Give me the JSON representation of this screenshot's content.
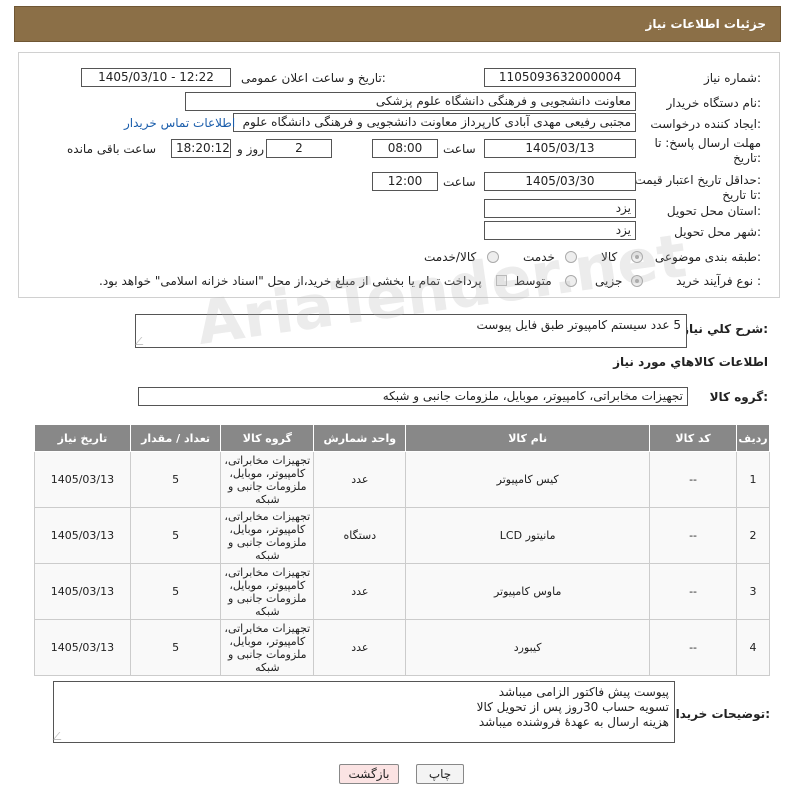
{
  "header": {
    "title": "جزئیات اطلاعات نیاز"
  },
  "fields": {
    "need_number_label": "شماره نیاز:",
    "need_number": "1105093632000004",
    "announce_label": "تاریخ و ساعت اعلان عمومی:",
    "announce_value": "1405/03/10 - 12:22",
    "buyer_org_label": "نام دستگاه خریدار:",
    "buyer_org": "معاونت دانشجویی و فرهنگی دانشگاه علوم پزشکی",
    "creator_label": "ایجاد کننده درخواست:",
    "creator": "مجتبی رفیعی مهدی آبادی کارپرداز معاونت دانشجویی و فرهنگی دانشگاه علوم",
    "contact_link": "اطلاعات تماس خریدار",
    "deadline_label_1": "مهلت ارسال پاسخ: تا",
    "deadline_label_2": "تاریخ:",
    "deadline_date": "1405/03/13",
    "time_label": "ساعت",
    "deadline_time": "08:00",
    "days_value": "2",
    "days_label": "روز و",
    "remaining_time": "18:20:12",
    "remaining_label": "ساعت باقی مانده",
    "price_label_1": "حداقل تاریخ اعتبار قیمت:",
    "price_label_2": "تا تاریخ:",
    "price_date": "1405/03/30",
    "price_time": "12:00",
    "province_label": "استان محل تحویل:",
    "province": "یزد",
    "city_label": "شهر محل تحویل:",
    "city": "یزد",
    "category_label": "طبقه بندی موضوعی:",
    "category_options": [
      "کالا",
      "خدمت",
      "کالا/خدمت"
    ],
    "process_label": "نوع فرآیند خرید :",
    "process_options": [
      "جزیی",
      "متوسط"
    ],
    "payment_note": "پرداخت تمام یا بخشی از مبلغ خرید،از محل \"اسناد خزانه اسلامی\" خواهد بود."
  },
  "summary": {
    "label": "شرح کلي نياز:",
    "value": "5 عدد سیستم کامپیوتر طبق فایل پیوست"
  },
  "goods_info": {
    "heading": "اطلاعات کالاهاي مورد نياز",
    "group_label": "گروه کالا:",
    "group_value": "تجهیزات مخابراتی، کامپیوتر، موبایل، ملزومات جانبی و شبکه"
  },
  "table": {
    "headers": [
      "ردیف",
      "کد کالا",
      "نام کالا",
      "واحد شمارش",
      "گروه کالا",
      "تعداد / مقدار",
      "تاریخ نیاز"
    ],
    "rows": [
      [
        "1",
        "--",
        "کیس کامپیوتر",
        "عدد",
        "تجهیزات مخابراتی، کامپیوتر، موبایل، ملزومات جانبی و شبکه",
        "5",
        "1405/03/13"
      ],
      [
        "2",
        "--",
        "مانیتور LCD",
        "دستگاه",
        "تجهیزات مخابراتی، کامپیوتر، موبایل، ملزومات جانبی و شبکه",
        "5",
        "1405/03/13"
      ],
      [
        "3",
        "--",
        "ماوس کامپیوتر",
        "عدد",
        "تجهیزات مخابراتی، کامپیوتر، موبایل، ملزومات جانبی و شبکه",
        "5",
        "1405/03/13"
      ],
      [
        "4",
        "--",
        "کیبورد",
        "عدد",
        "تجهیزات مخابراتی، کامپیوتر، موبایل، ملزومات جانبی و شبکه",
        "5",
        "1405/03/13"
      ]
    ]
  },
  "buyer_notes": {
    "label": "توضیحات خریدار:",
    "lines": [
      "پیوست پیش فاکتور الزامی میباشد",
      "تسویه حساب 30روز پس از تحویل کالا",
      "هزینه ارسال به عهدهٔ فروشنده میباشد"
    ]
  },
  "buttons": {
    "print": "چاپ",
    "back": "بازگشت"
  },
  "watermark": "AriaTender.net",
  "colors": {
    "header_bg": "#8b6f47",
    "table_header_bg": "#888888",
    "link": "#1a5dab",
    "back_btn_bg": "#fbe3e3"
  }
}
